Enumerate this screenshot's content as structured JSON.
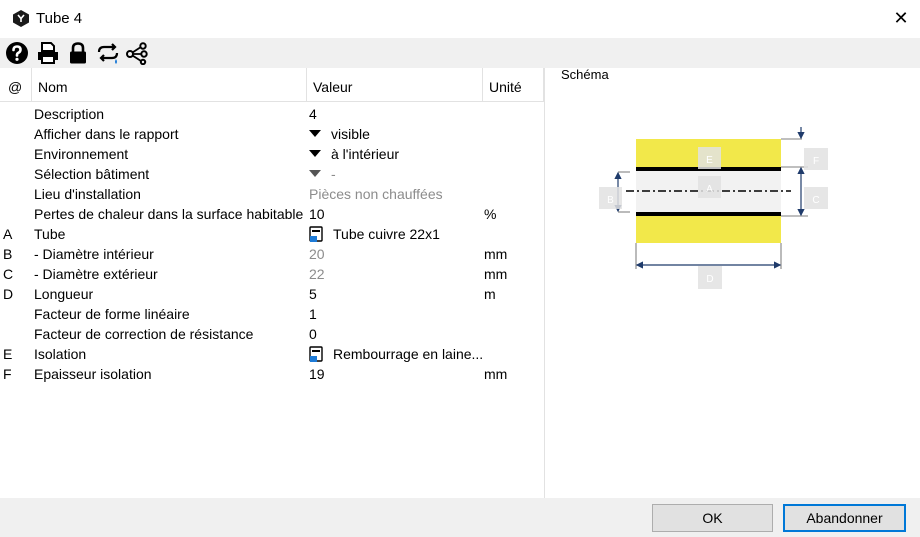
{
  "window": {
    "title": "Tube 4",
    "close_glyph": "✕"
  },
  "toolbar": {
    "icons": [
      "help-icon",
      "print-icon",
      "lock-icon",
      "swap-icon",
      "network-icon"
    ]
  },
  "grid": {
    "headers": {
      "at": "@",
      "name": "Nom",
      "value": "Valeur",
      "unit": "Unité"
    },
    "rows": [
      {
        "letter": "",
        "name": "Description",
        "value": "4",
        "unit": ""
      },
      {
        "letter": "",
        "name": "Afficher dans le rapport",
        "value": "visible",
        "unit": ""
      },
      {
        "letter": "",
        "name": "Environnement",
        "value": "à l'intérieur",
        "unit": ""
      },
      {
        "letter": "",
        "name": "Sélection bâtiment",
        "value": "-",
        "unit": ""
      },
      {
        "letter": "",
        "name": "Lieu d'installation",
        "value": "Pièces non chauffées",
        "unit": ""
      },
      {
        "letter": "",
        "name": "Pertes de chaleur dans la surface habitable",
        "value": "10",
        "unit": "%"
      },
      {
        "letter": "A",
        "name": "Tube",
        "value": "Tube cuivre 22x1",
        "unit": ""
      },
      {
        "letter": "B",
        "name": "- Diamètre intérieur",
        "value": "20",
        "unit": "mm"
      },
      {
        "letter": "C",
        "name": "- Diamètre extérieur",
        "value": "22",
        "unit": "mm"
      },
      {
        "letter": "D",
        "name": "Longueur",
        "value": "5",
        "unit": "m"
      },
      {
        "letter": "",
        "name": "Facteur de forme linéaire",
        "value": "1",
        "unit": ""
      },
      {
        "letter": "",
        "name": "Facteur de correction de résistance",
        "value": "0",
        "unit": ""
      },
      {
        "letter": "E",
        "name": "Isolation",
        "value": "Rembourrage en laine...",
        "unit": ""
      },
      {
        "letter": "F",
        "name": "Epaisseur isolation",
        "value": "19",
        "unit": "mm"
      }
    ]
  },
  "schema": {
    "label": "Schéma",
    "markers": {
      "a": "A",
      "b": "B",
      "c": "C",
      "d": "D",
      "e": "E",
      "f": "F"
    },
    "insulation_color": "#f2e84a"
  },
  "footer": {
    "ok": "OK",
    "cancel": "Abandonner"
  },
  "colors": {
    "accent": "#0078d7",
    "panel": "#f0f0f0"
  }
}
